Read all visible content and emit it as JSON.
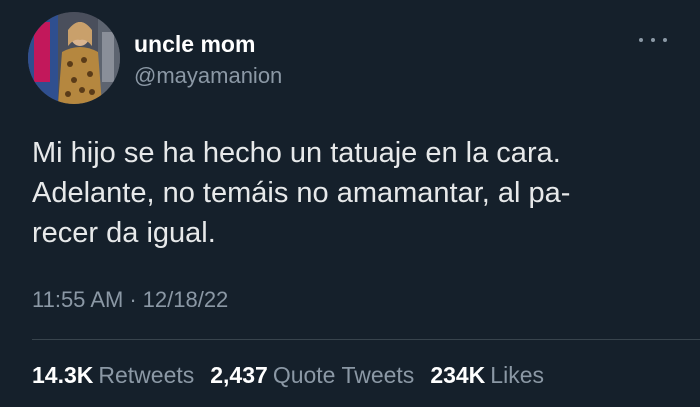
{
  "user": {
    "display_name": "uncle mom",
    "handle": "@mayamanion",
    "avatar_icon": "profile-photo"
  },
  "more_icon": "more-horizontal-icon",
  "tweet": {
    "lines": [
      "Mi hijo se ha hecho un tatuaje en la cara.",
      "Adelante, no temáis no amamantar, al pa-",
      "recer da igual."
    ],
    "time": "11:55 AM",
    "separator": "·",
    "date": "12/18/22"
  },
  "stats": {
    "retweets_count": "14.3K",
    "retweets_label": "Retweets",
    "quotes_count": "2,437",
    "quotes_label": "Quote Tweets",
    "likes_count": "234K",
    "likes_label": "Likes"
  },
  "colors": {
    "background": "#15202b",
    "primary_text": "#e7e9ea",
    "secondary_text": "#8b98a5",
    "divider": "#38444d"
  }
}
